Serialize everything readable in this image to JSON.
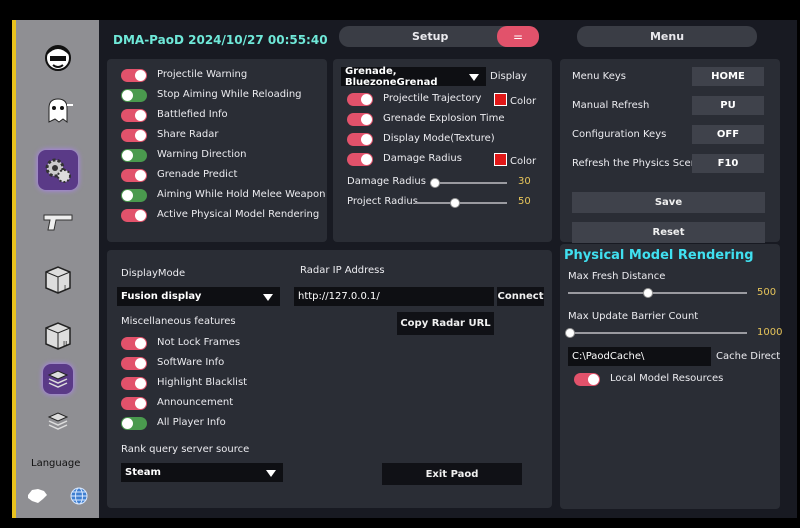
{
  "sidebar": {
    "language_label": "Language",
    "icons": [
      "avatar-icon",
      "ghost-icon",
      "gears-icon",
      "pistol-icon",
      "box-1-icon",
      "box-2-icon",
      "layers-1-icon",
      "layers-2-icon"
    ]
  },
  "header": {
    "title": "DMA-PaoD 2024/10/27 00:55:40",
    "setup_tab": "Setup",
    "menu_toggle": "=",
    "menu_tab": "Menu"
  },
  "warnings": [
    {
      "label": "Projectile Warning",
      "on": true
    },
    {
      "label": "Stop Aiming While Reloading",
      "on": false
    },
    {
      "label": "Battlefied Info",
      "on": true
    },
    {
      "label": "Share Radar",
      "on": true
    },
    {
      "label": "Warning Direction",
      "on": false
    },
    {
      "label": "Grenade Predict",
      "on": true
    },
    {
      "label": "Aiming While Hold Melee Weapon",
      "on": false
    },
    {
      "label": "Active Physical Model Rendering",
      "on": true
    }
  ],
  "grenade": {
    "select_value": "Grenade, BluezoneGrenad",
    "display_label": "Display",
    "options": [
      {
        "label": "Projectile Trajectory",
        "on": true,
        "color_label": "Color"
      },
      {
        "label": "Grenade Explosion Time",
        "on": true
      },
      {
        "label": "Display Mode(Texture)",
        "on": true
      },
      {
        "label": "Damage Radius",
        "on": true,
        "color_label": "Color"
      }
    ],
    "sliders": [
      {
        "label": "Damage Radius",
        "value": "30"
      },
      {
        "label": "Project Radius",
        "value": "50"
      }
    ]
  },
  "menu_keys": [
    {
      "label": "Menu Keys",
      "key": "HOME"
    },
    {
      "label": "Manual Refresh",
      "key": "PU"
    },
    {
      "label": "Configuration Keys",
      "key": "OFF"
    },
    {
      "label": "Refresh the Physics Scene",
      "key": "F10"
    }
  ],
  "config": {
    "save": "Save",
    "reset": "Reset"
  },
  "physical": {
    "title": "Physical Model Rendering",
    "max_fresh_label": "Max Fresh Distance",
    "max_fresh_value": "500",
    "max_barrier_label": "Max Update Barrier Count",
    "max_barrier_value": "1000",
    "cache_path": "C:\\PaodCache\\",
    "cache_label": "Cache Directo",
    "local_label": "Local Model Resources",
    "local_on": true
  },
  "bottom": {
    "display_mode_label": "DisplayMode",
    "display_mode_value": "Fusion display",
    "radar_label": "Radar IP Address",
    "radar_value": "http://127.0.0.1/",
    "connect": "Connect",
    "copy_url": "Copy Radar URL",
    "misc_label": "Miscellaneous features",
    "misc": [
      {
        "label": "Not Lock Frames",
        "on": true
      },
      {
        "label": "SoftWare Info",
        "on": true
      },
      {
        "label": "Highlight Blacklist",
        "on": true
      },
      {
        "label": "Announcement",
        "on": true
      },
      {
        "label": "All Player Info",
        "on": false
      }
    ],
    "rank_label": "Rank query server source",
    "rank_value": "Steam",
    "exit": "Exit Paod"
  },
  "colors": {
    "accent": "#e2526b",
    "off": "#4a9a4e",
    "value": "#e6c45a",
    "title": "#40e0f0",
    "sidebar": "#8f8f93"
  }
}
